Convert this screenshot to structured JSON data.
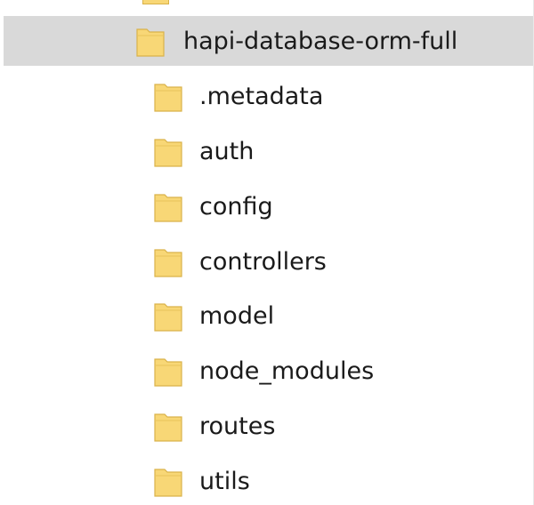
{
  "tree": {
    "root": {
      "label": "hapi-database-orm-full",
      "icon": "folder-icon"
    },
    "children": [
      {
        "label": ".metadata",
        "icon": "folder-icon"
      },
      {
        "label": "auth",
        "icon": "folder-icon"
      },
      {
        "label": "config",
        "icon": "folder-icon"
      },
      {
        "label": "controllers",
        "icon": "folder-icon"
      },
      {
        "label": "model",
        "icon": "folder-icon"
      },
      {
        "label": "node_modules",
        "icon": "folder-icon"
      },
      {
        "label": "routes",
        "icon": "folder-icon"
      },
      {
        "label": "utils",
        "icon": "folder-icon"
      }
    ]
  },
  "colors": {
    "selection": "#d9d9d9",
    "folder_fill": "#f8d776",
    "folder_edge": "#d9b24a",
    "text": "#1a1a1a"
  }
}
